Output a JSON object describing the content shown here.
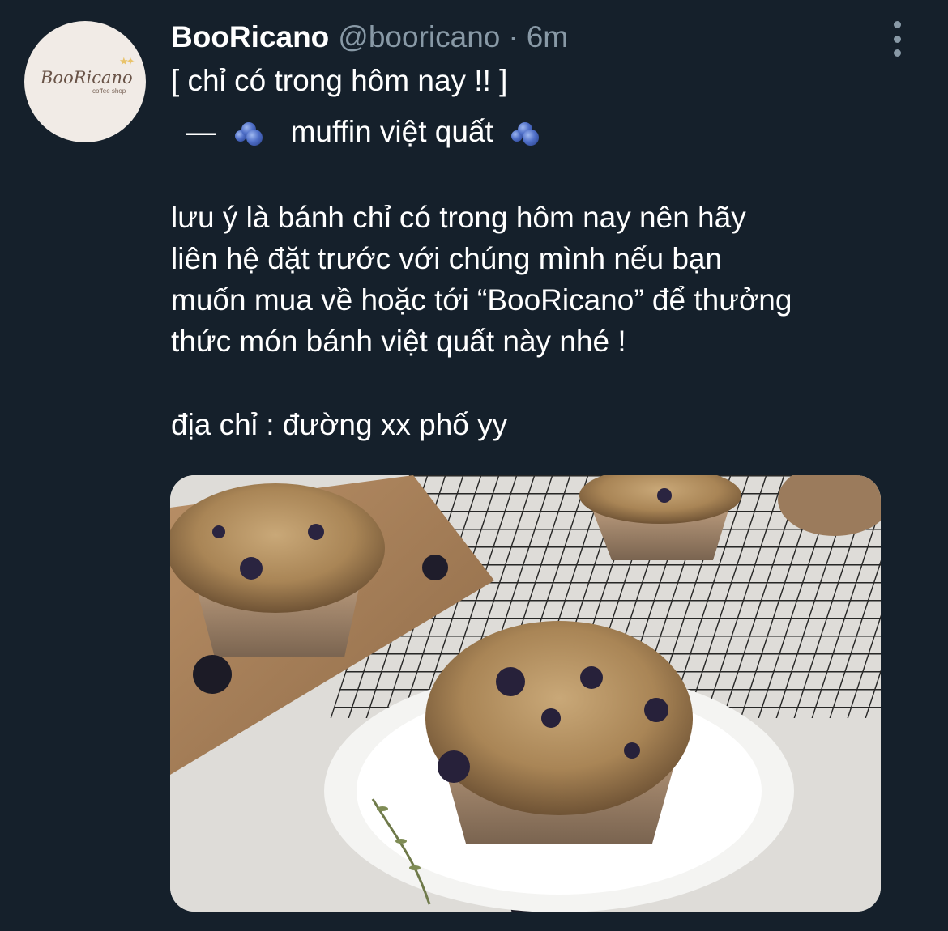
{
  "author": {
    "display_name": "BooRicano",
    "handle": "@booricano",
    "separator": "·",
    "timestamp": "6m",
    "avatar_wordmark": "BooRicano",
    "avatar_subtitle": "coffee shop"
  },
  "tweet": {
    "lines": [
      "[ chỉ có trong hôm nay !! ]",
      "muffin việt quất",
      "lưu ý là bánh chỉ có trong hôm nay nên hãy",
      "liên hệ đặt trước với chúng mình nếu bạn",
      "muốn mua về hoặc tới “BooRicano” để thưởng",
      "thức món bánh việt quất này nhé !",
      "địa chỉ : đường xx phố yy"
    ],
    "dash": "—",
    "emoji": "blueberries"
  },
  "colors": {
    "background": "#15202b",
    "primary_text": "#ffffff",
    "secondary_text": "#8899a6"
  },
  "icons": {
    "more": "more-vertical-icon",
    "emoji": "blueberries-icon"
  }
}
